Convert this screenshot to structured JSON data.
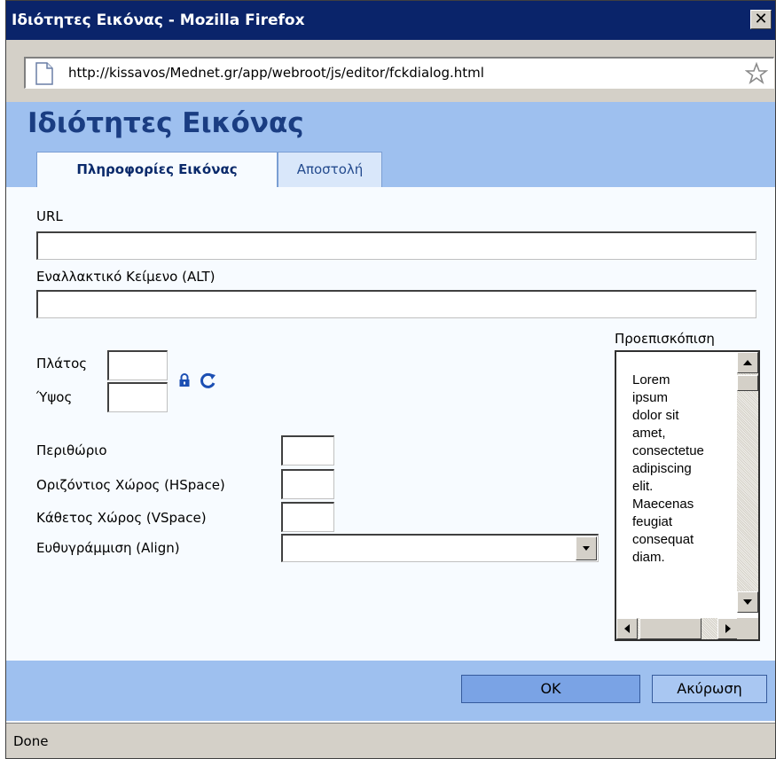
{
  "window": {
    "title": "Ιδιότητες Εικόνας - Mozilla Firefox",
    "close_label": "✕"
  },
  "addressbar": {
    "url": "http://kissavos/Mednet.gr/app/webroot/js/editor/fckdialog.html"
  },
  "dialog": {
    "title": "Ιδιότητες Εικόνας",
    "tabs": [
      {
        "label": "Πληροφορίες Εικόνας",
        "active": true
      },
      {
        "label": "Αποστολή",
        "active": false
      }
    ],
    "fields": {
      "url_label": "URL",
      "url_value": "",
      "alt_label": "Εναλλακτικό Κείμενο (ALT)",
      "alt_value": "",
      "width_label": "Πλάτος",
      "height_label": "Ύψος",
      "border_label": "Περιθώριο",
      "hspace_label": "Οριζόντιος Χώρος (HSpace)",
      "vspace_label": "Κάθετος Χώρος (VSpace)",
      "align_label": "Ευθυγράμμιση (Align)",
      "align_value": ""
    },
    "preview": {
      "label": "Προεπισκόπιση",
      "text_lines": [
        "Lorem",
        "ipsum",
        "dolor sit",
        "amet,",
        "consectetue",
        "adipiscing",
        "elit.",
        "Maecenas",
        "feugiat",
        "consequat",
        "diam."
      ]
    },
    "buttons": {
      "ok": "OK",
      "cancel": "Ακύρωση"
    }
  },
  "status": {
    "text": "Done"
  },
  "icons": {
    "page": "page-icon",
    "star": "star-icon",
    "lock": "lock-icon",
    "reset": "reset-size-icon"
  }
}
